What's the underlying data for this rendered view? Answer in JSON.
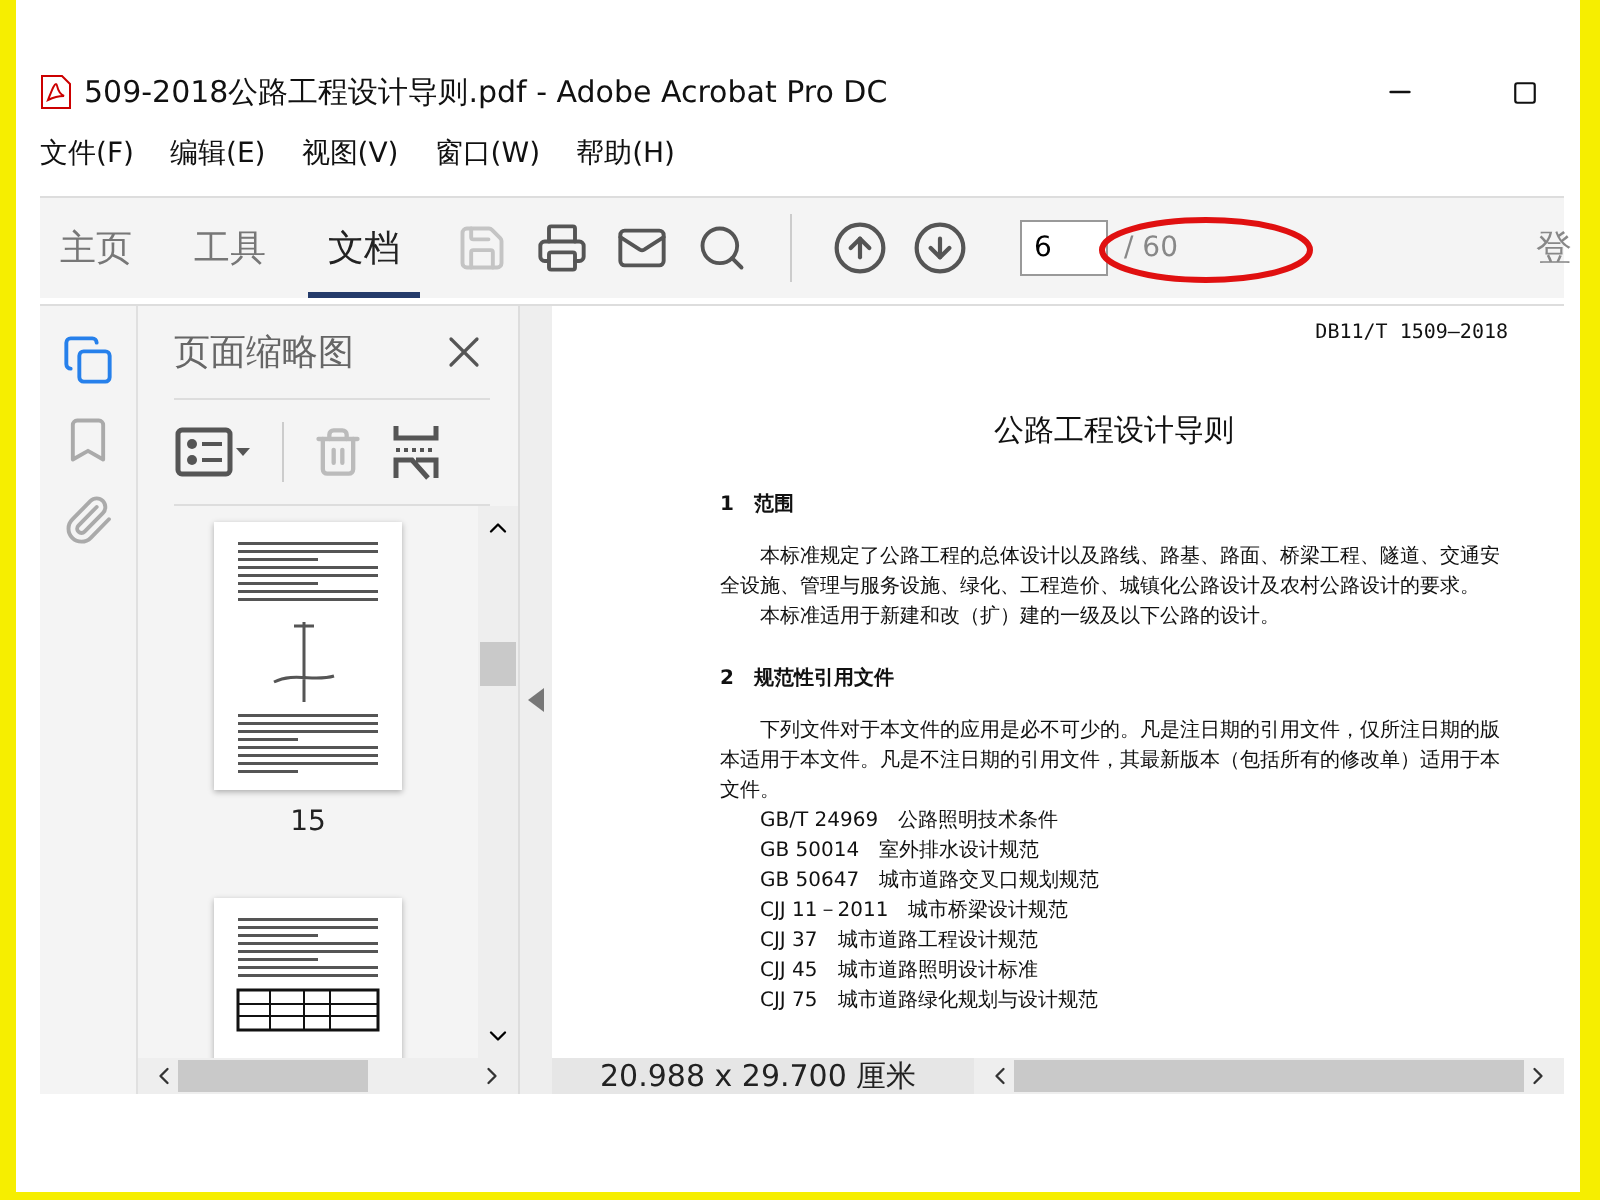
{
  "window": {
    "title": "509-2018公路工程设计导则.pdf - Adobe Acrobat Pro DC"
  },
  "menu": [
    "文件(F)",
    "编辑(E)",
    "视图(V)",
    "窗口(W)",
    "帮助(H)"
  ],
  "tabs": [
    {
      "label": "主页",
      "selected": false
    },
    {
      "label": "工具",
      "selected": false
    },
    {
      "label": "文档",
      "selected": true
    }
  ],
  "toolbar": [
    {
      "kind": "save",
      "disabled": true
    },
    {
      "kind": "print",
      "disabled": false
    },
    {
      "kind": "mail",
      "disabled": false
    },
    {
      "kind": "search",
      "disabled": false
    },
    {
      "kind": "up",
      "disabled": false
    },
    {
      "kind": "down",
      "disabled": false
    }
  ],
  "page_field": {
    "value": "6",
    "total": "/ 60"
  },
  "sign_in": "登",
  "rail": [
    {
      "kind": "pages",
      "selected": true
    },
    {
      "kind": "bookmarks",
      "selected": false
    },
    {
      "kind": "attachments",
      "selected": false
    }
  ],
  "panel": {
    "title": "页面缩略图",
    "tools": [
      {
        "kind": "options",
        "disabled": false
      },
      {
        "kind": "delete",
        "disabled": true
      },
      {
        "kind": "insert",
        "disabled": false
      }
    ],
    "thumbnails": [
      {
        "kind": "figure",
        "label": "15"
      },
      {
        "kind": "table"
      }
    ]
  },
  "document": {
    "header": "DB11/T 1509—2018",
    "title": "公路工程设计导则",
    "blocks": [
      {
        "kind": "heading",
        "text": "1　范围"
      },
      {
        "kind": "para",
        "text": "本标准规定了公路工程的总体设计以及路线、路基、路面、桥梁工程、隧道、交通安全设施、管理与服务设施、绿化、工程造价、城镇化公路设计及农村公路设计的要求。"
      },
      {
        "kind": "para",
        "text": "本标准适用于新建和改（扩）建的一级及以下公路的设计。"
      },
      {
        "kind": "heading",
        "text": "2　规范性引用文件"
      },
      {
        "kind": "para",
        "text": "下列文件对于本文件的应用是必不可少的。凡是注日期的引用文件，仅所注日期的版本适用于本文件。凡是不注日期的引用文件，其最新版本（包括所有的修改单）适用于本文件。"
      },
      {
        "kind": "ref",
        "code": "GB/T 24969",
        "text": "公路照明技术条件"
      },
      {
        "kind": "ref",
        "code": "GB 50014",
        "text": "室外排水设计规范"
      },
      {
        "kind": "ref",
        "code": "GB 50647",
        "text": "城市道路交叉口规划规范"
      },
      {
        "kind": "ref",
        "code": "CJJ 11－2011",
        "text": "城市桥梁设计规范"
      },
      {
        "kind": "ref",
        "code": "CJJ 37",
        "text": "城市道路工程设计规范"
      },
      {
        "kind": "ref",
        "code": "CJJ 45",
        "text": "城市道路照明设计标准"
      },
      {
        "kind": "ref",
        "code": "CJJ 75",
        "text": "城市道路绿化规划与设计规范"
      }
    ]
  },
  "status": {
    "page_size": "20.988 x 29.700 厘米"
  }
}
